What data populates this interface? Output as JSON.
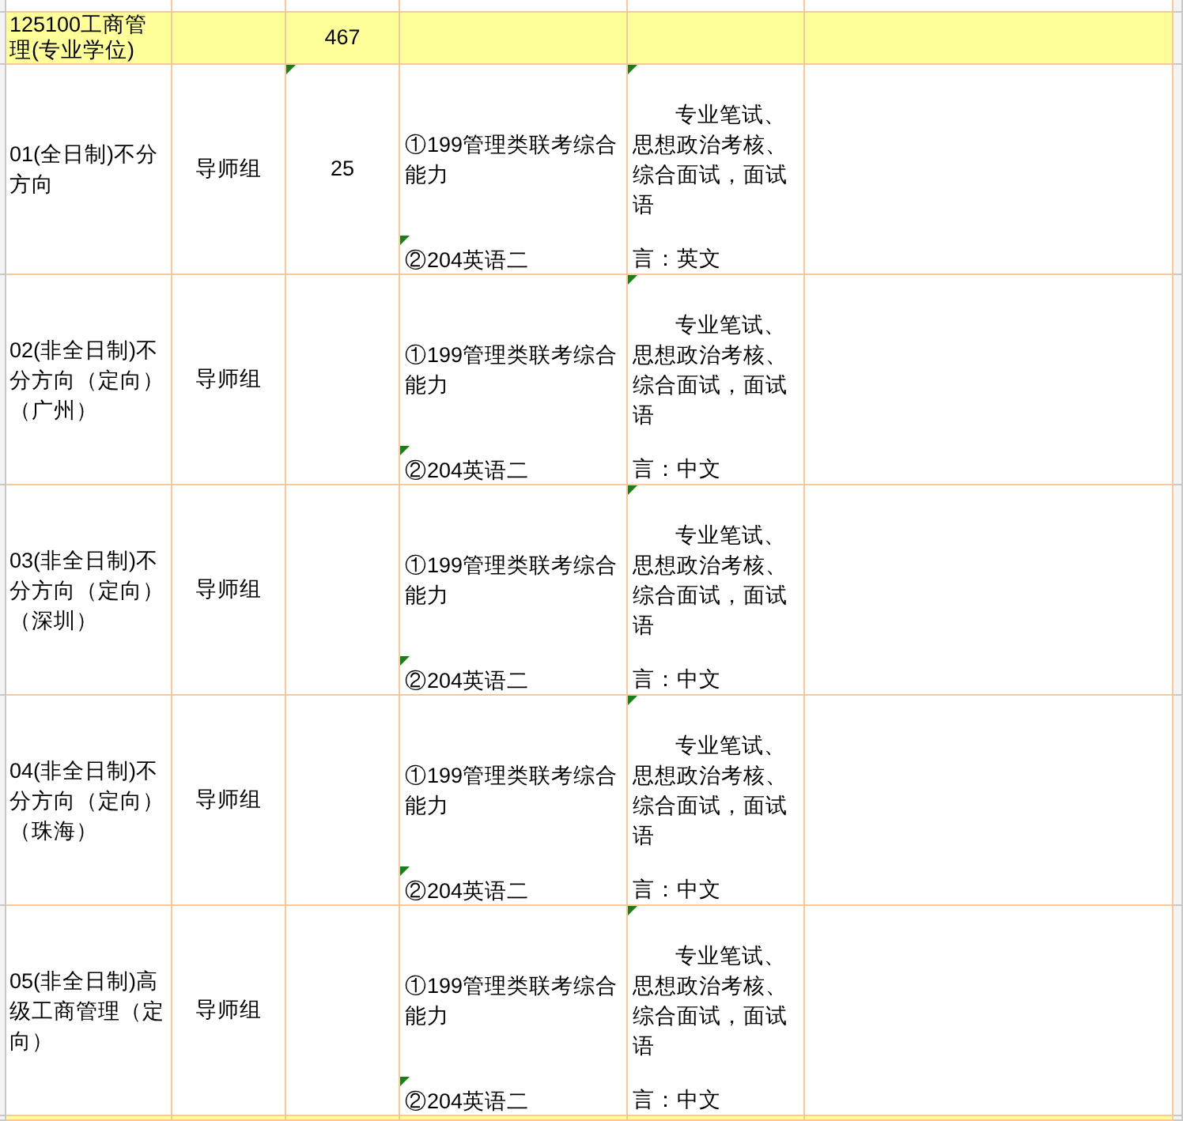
{
  "header_row": {
    "name": "125100工商管理(专业学位)",
    "quota": "467"
  },
  "rows": [
    {
      "direction": "01(全日制)不分方向",
      "supervisor": "导师组",
      "quota": "25",
      "subject_1": "①199管理类联考综合能力",
      "subject_2": "②204英语二",
      "exam": "专业笔试、思想政治考核、综合面试，面试语",
      "exam_language": "言：英文",
      "quota_note": true
    },
    {
      "direction": "02(非全日制)不分方向（定向）（广州）",
      "supervisor": "导师组",
      "quota": "",
      "subject_1": "①199管理类联考综合能力",
      "subject_2": "②204英语二",
      "exam": "专业笔试、思想政治考核、综合面试，面试语",
      "exam_language": "言：中文",
      "quota_note": false
    },
    {
      "direction": "03(非全日制)不分方向（定向）（深圳）",
      "supervisor": "导师组",
      "quota": "",
      "subject_1": "①199管理类联考综合能力",
      "subject_2": "②204英语二",
      "exam": "专业笔试、思想政治考核、综合面试，面试语",
      "exam_language": "言：中文",
      "quota_note": false
    },
    {
      "direction": "04(非全日制)不分方向（定向）（珠海）",
      "supervisor": "导师组",
      "quota": "",
      "subject_1": "①199管理类联考综合能力",
      "subject_2": "②204英语二",
      "exam": "专业笔试、思想政治考核、综合面试，面试语",
      "exam_language": "言：中文",
      "quota_note": false
    },
    {
      "direction": "05(非全日制)高级工商管理（定向）",
      "supervisor": "导师组",
      "quota": "",
      "subject_1": "①199管理类联考综合能力",
      "subject_2": "②204英语二",
      "exam": "专业笔试、思想政治考核、综合面试，面试语",
      "exam_language": "言：中文",
      "quota_note": false
    }
  ]
}
